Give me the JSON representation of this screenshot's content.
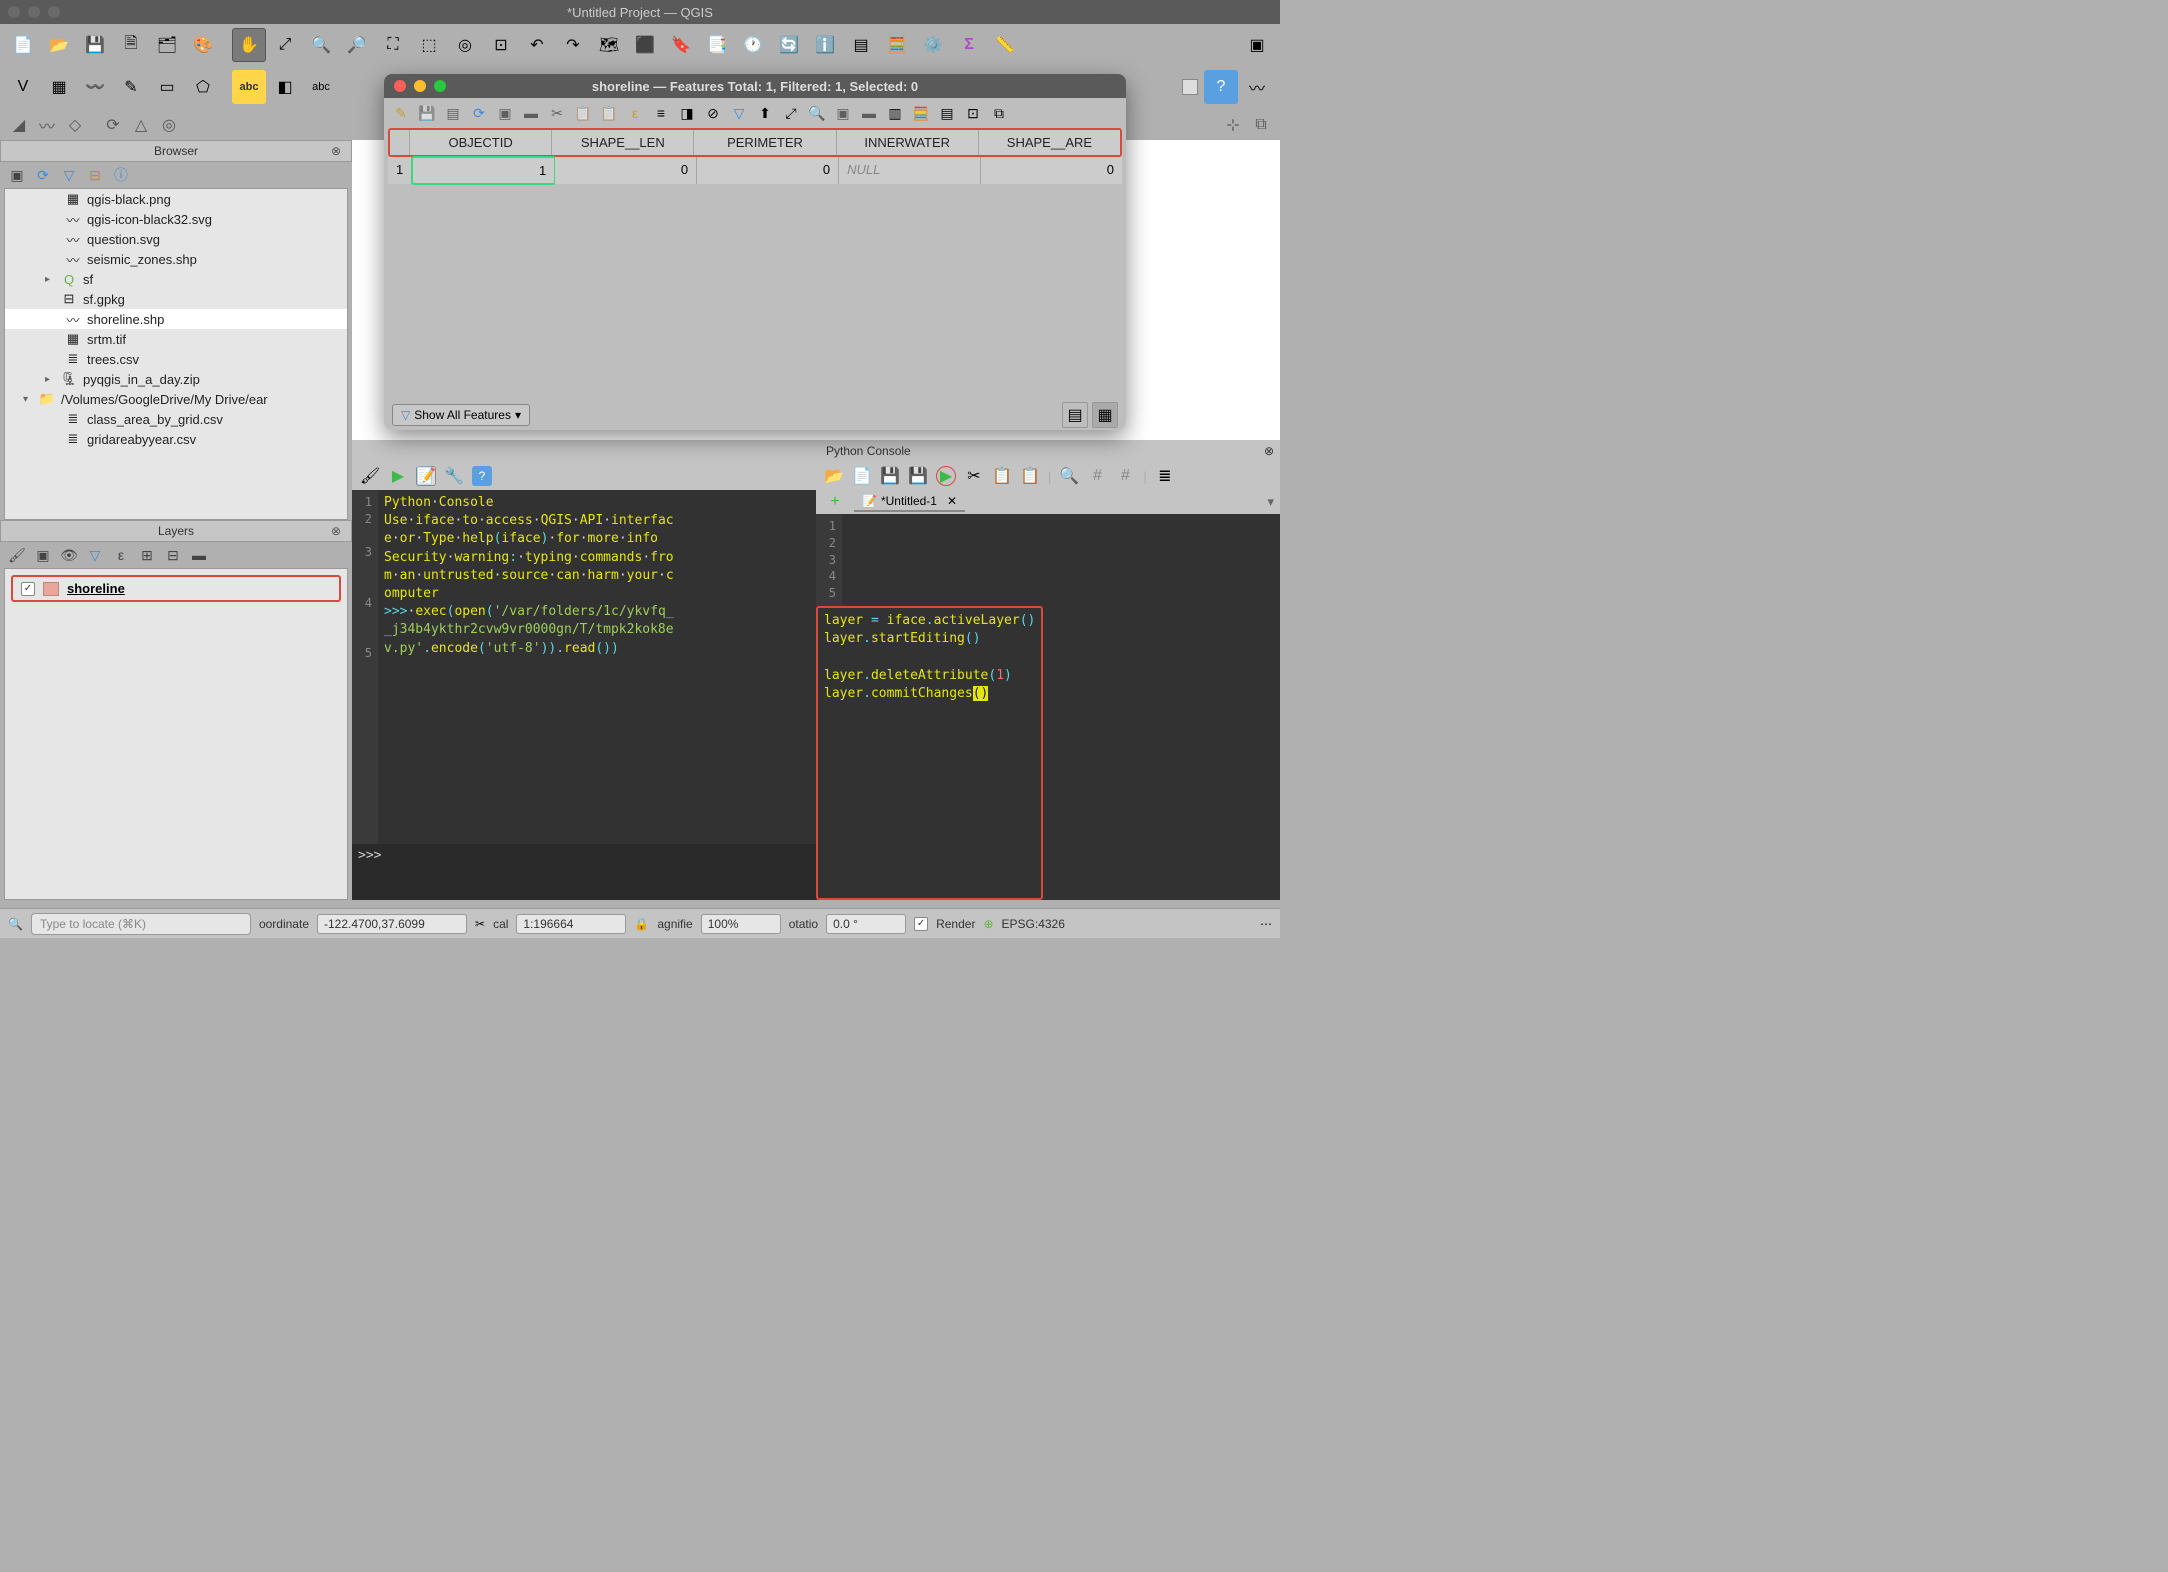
{
  "window": {
    "title": "*Untitled Project — QGIS"
  },
  "browser": {
    "title": "Browser",
    "items": [
      {
        "name": "qgis-black.png",
        "icon": "raster"
      },
      {
        "name": "qgis-icon-black32.svg",
        "icon": "vector"
      },
      {
        "name": "question.svg",
        "icon": "vector"
      },
      {
        "name": "seismic_zones.shp",
        "icon": "vector"
      },
      {
        "name": "sf",
        "icon": "qgis",
        "expander": "right",
        "level": 1
      },
      {
        "name": "sf.gpkg",
        "icon": "db",
        "level": 1
      },
      {
        "name": "shoreline.shp",
        "icon": "vector",
        "selected": true
      },
      {
        "name": "srtm.tif",
        "icon": "raster"
      },
      {
        "name": "trees.csv",
        "icon": "csv"
      },
      {
        "name": "pyqgis_in_a_day.zip",
        "icon": "zip",
        "expander": "right",
        "level": 1
      },
      {
        "name": "/Volumes/GoogleDrive/My Drive/ear",
        "icon": "folder",
        "expander": "down",
        "level": 0
      },
      {
        "name": "class_area_by_grid.csv",
        "icon": "csv"
      },
      {
        "name": "gridareabyyear.csv",
        "icon": "csv"
      }
    ]
  },
  "layers": {
    "title": "Layers",
    "items": [
      {
        "name": "shoreline",
        "checked": true,
        "color": "#e8a79a"
      }
    ]
  },
  "attr": {
    "title": "shoreline — Features Total: 1, Filtered: 1, Selected: 0",
    "columns": [
      "OBJECTID",
      "SHAPE__LEN",
      "PERIMETER",
      "INNERWATER",
      "SHAPE__ARE"
    ],
    "rows": [
      {
        "index": "1",
        "cells": [
          "1",
          "0",
          "0",
          "NULL",
          "0"
        ]
      }
    ],
    "show_all": "Show All Features"
  },
  "python": {
    "title": "Python Console",
    "lines": [
      "Python Console",
      "Use iface to access QGIS API interface or Type help(iface) for more info",
      "Security warning: typing commands from an untrusted source can harm your computer",
      ">>> exec(open('/var/folders/1c/ykvfq__j34b4ykthr2cvw9vr0000gn/T/tmpk2kok8ev.py'.encode('utf-8')).read())"
    ],
    "prompt": ">>> ",
    "editor_tab": "*Untitled-1",
    "editor_lines": [
      "layer = iface.activeLayer()",
      "layer.startEditing()",
      "",
      "layer.deleteAttribute(1)",
      "layer.commitChanges()"
    ]
  },
  "status": {
    "locator_placeholder": "Type to locate (⌘K)",
    "coord_label": "oordinate",
    "coord_val": "-122.4700,37.6099",
    "scale_label": "cal",
    "scale_val": "1:196664",
    "mag_label": "agnifie",
    "mag_val": "100%",
    "rot_label": "otatio",
    "rot_val": "0.0 °",
    "render": "Render",
    "epsg": "EPSG:4326"
  }
}
